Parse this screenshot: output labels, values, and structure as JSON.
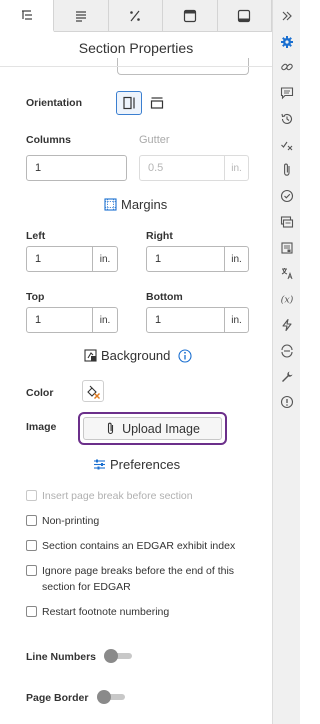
{
  "header": {
    "title": "Section Properties"
  },
  "tabs": [
    {
      "name": "tab-outline",
      "icon": "outline-icon"
    },
    {
      "name": "tab-paragraph",
      "icon": "paragraph-icon"
    },
    {
      "name": "tab-number-format",
      "icon": "percent-format-icon"
    },
    {
      "name": "tab-header",
      "icon": "header-layout-icon"
    },
    {
      "name": "tab-footer",
      "icon": "footer-layout-icon"
    }
  ],
  "orientation": {
    "label": "Orientation",
    "selected": "portrait"
  },
  "columns": {
    "label": "Columns",
    "value": "1"
  },
  "gutter": {
    "label": "Gutter",
    "value": "0.5",
    "unit": "in."
  },
  "margins": {
    "heading": "Margins",
    "left": {
      "label": "Left",
      "value": "1",
      "unit": "in."
    },
    "right": {
      "label": "Right",
      "value": "1",
      "unit": "in."
    },
    "top": {
      "label": "Top",
      "value": "1",
      "unit": "in."
    },
    "bottom": {
      "label": "Bottom",
      "value": "1",
      "unit": "in."
    }
  },
  "background": {
    "heading": "Background",
    "color_label": "Color",
    "image_label": "Image",
    "upload_label": "Upload Image"
  },
  "preferences": {
    "heading": "Preferences",
    "options": [
      {
        "label": "Insert page break before section",
        "checked": false,
        "disabled": true
      },
      {
        "label": "Non-printing",
        "checked": false,
        "disabled": false
      },
      {
        "label": "Section contains an EDGAR exhibit index",
        "checked": false,
        "disabled": false
      },
      {
        "label": "Ignore page breaks before the end of this",
        "label2": "section for EDGAR",
        "checked": false,
        "disabled": false
      },
      {
        "label": "Restart footnote numbering",
        "checked": false,
        "disabled": false
      }
    ],
    "line_numbers_label": "Line Numbers",
    "page_border_label": "Page Border",
    "line_numbers_on": false,
    "page_border_on": false
  },
  "rail": {
    "expand": "double-chevron-right-icon",
    "icons": [
      "gear-icon",
      "link-icon",
      "comment-icon",
      "history-icon",
      "check-x-icon",
      "paperclip-icon",
      "check-circle-icon",
      "layers-icon",
      "document-icon",
      "translate-icon",
      "formula-icon",
      "lightning-icon",
      "sync-icon",
      "wrench-icon",
      "alert-icon"
    ],
    "accent": "#1a6fd0"
  }
}
